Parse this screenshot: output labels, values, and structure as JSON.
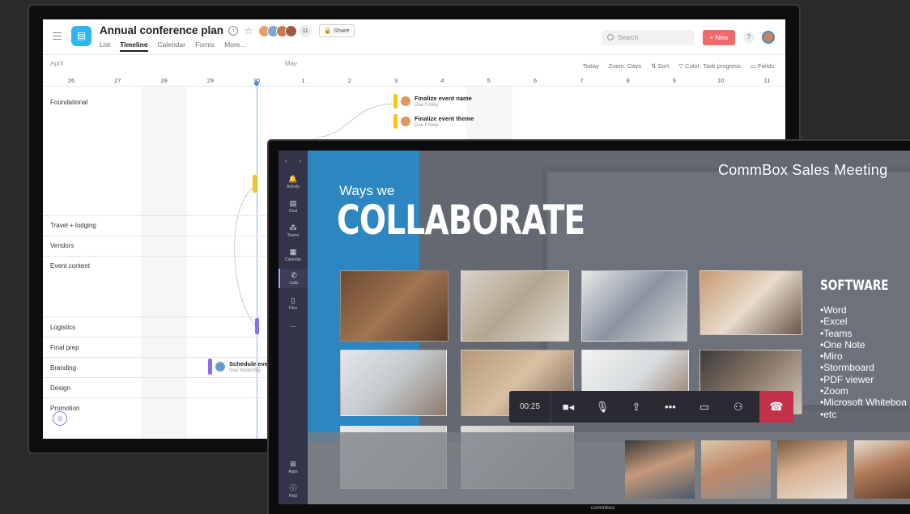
{
  "asana": {
    "project_title": "Annual conference plan",
    "member_count": "11",
    "share_label": "Share",
    "tabs": [
      "List",
      "Timeline",
      "Calendar",
      "Forms",
      "More..."
    ],
    "active_tab": "Timeline",
    "search_placeholder": "Search",
    "new_label": "New",
    "help_label": "?",
    "months": [
      "April",
      "May"
    ],
    "days": [
      "26",
      "27",
      "28",
      "29",
      "30",
      "1",
      "2",
      "3",
      "4",
      "5",
      "6",
      "7",
      "8",
      "9",
      "10",
      "11"
    ],
    "toolbar": [
      "Today",
      "Zoom: Days",
      "Sort",
      "Color: Task progress",
      "Fields"
    ],
    "rows": [
      "Foundational",
      "Travel + lodging",
      "Vendors",
      "Event content",
      "Logistics",
      "Final prep",
      "Branding",
      "Design",
      "Promotion"
    ],
    "tasks": [
      {
        "name": "Finalize event name",
        "due": "Due Friday",
        "color": "#f5c518"
      },
      {
        "name": "Finalize event theme",
        "due": "Due Friday",
        "color": "#f5c518"
      },
      {
        "name": "Schedule eve",
        "due": "Due Yesterday",
        "color": "#8b6cf6"
      }
    ],
    "colors": {
      "accent": "#2fb5f2",
      "new_button": "#f06a6a",
      "today_line": "#4a90e2"
    }
  },
  "teams": {
    "rail": [
      {
        "icon": "bell-icon",
        "label": "Activity"
      },
      {
        "icon": "chat-icon",
        "label": "Chat"
      },
      {
        "icon": "teams-icon",
        "label": "Teams"
      },
      {
        "icon": "calendar-icon",
        "label": "Calendar"
      },
      {
        "icon": "phone-icon",
        "label": "Calls"
      },
      {
        "icon": "file-icon",
        "label": "Files"
      },
      {
        "icon": "more-icon",
        "label": "..."
      },
      {
        "icon": "apps-icon",
        "label": "Apps"
      },
      {
        "icon": "help-icon",
        "label": "Help"
      }
    ],
    "meeting_title": "CommBox Sales Meeting",
    "slide_heading_small": "Ways we",
    "slide_heading_big": "COLLABORATE",
    "software_title": "SOFTWARE",
    "software_list": [
      "•Word",
      "•Excel",
      "•Teams",
      "•One Note",
      "•Miro",
      "•Stormboard",
      "•PDF viewer",
      "•Zoom",
      "•Microsoft Whiteboa",
      "•etc"
    ],
    "call_time": "00:25",
    "brand": "commbox",
    "colors": {
      "rail": "#33344a",
      "slide_blue": "#2d86c0",
      "end_call": "#c4314b"
    }
  }
}
